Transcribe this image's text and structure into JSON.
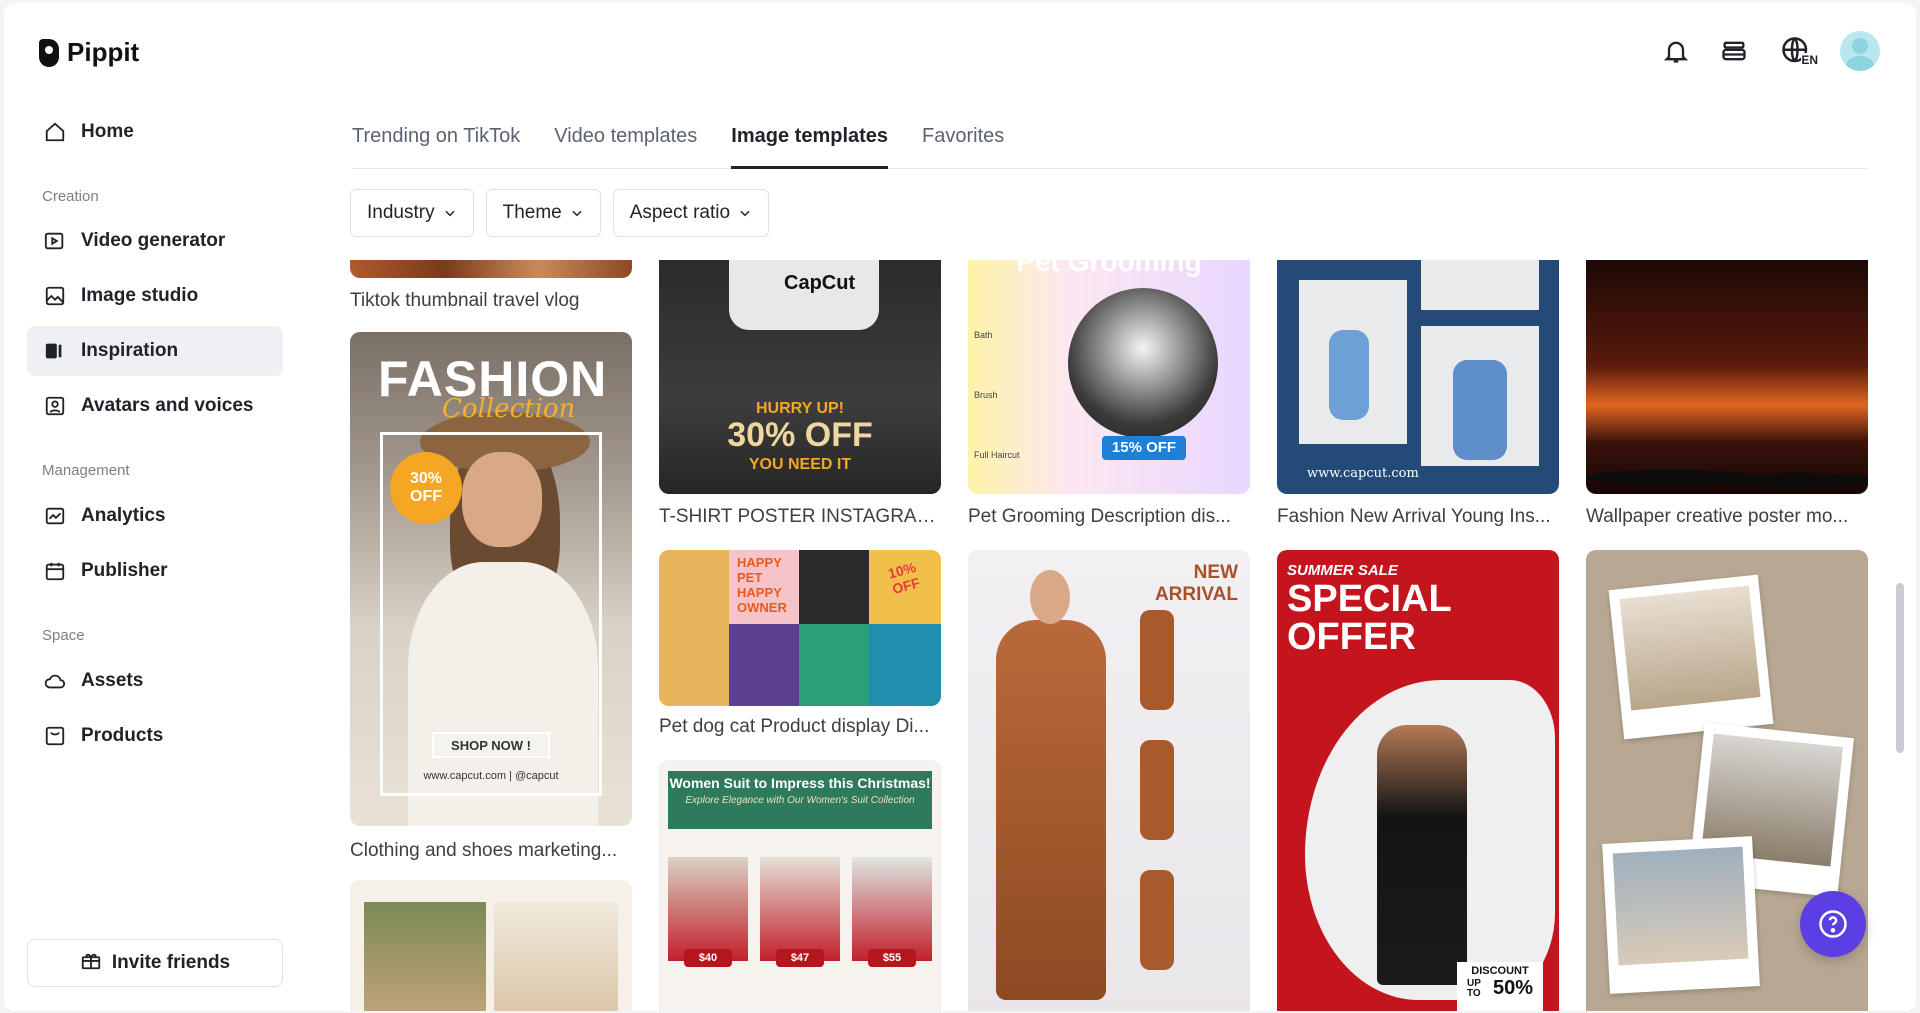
{
  "app": {
    "name": "Pippit"
  },
  "sidebar": {
    "home": "Home",
    "sections": {
      "creation": "Creation",
      "management": "Management",
      "space": "Space"
    },
    "items": {
      "video_generator": "Video generator",
      "image_studio": "Image studio",
      "inspiration": "Inspiration",
      "avatars": "Avatars and voices",
      "analytics": "Analytics",
      "publisher": "Publisher",
      "assets": "Assets",
      "products": "Products"
    },
    "invite": "Invite friends"
  },
  "header": {
    "lang_badge": "EN"
  },
  "tabs": [
    "Trending on TikTok",
    "Video templates",
    "Image templates",
    "Favorites"
  ],
  "filters": [
    "Industry",
    "Theme",
    "Aspect ratio"
  ],
  "cards": {
    "c1": {
      "caption": "Tiktok thumbnail travel vlog"
    },
    "c2": {
      "caption": "Clothing and shoes marketing...",
      "title": "FASHION",
      "subtitle": "Collection",
      "badge": "30% OFF",
      "cta": "SHOP NOW !",
      "footer": "www.capcut.com | @capcut"
    },
    "c3": {
      "caption": "T-SHIRT POSTER INSTAGRAM...",
      "brand": "CapCut",
      "line1": "HURRY UP!",
      "line2": "30% OFF",
      "line3": "YOU NEED IT"
    },
    "c4": {
      "caption": "Pet dog cat Product display Di...",
      "text": "HAPPY PET HAPPY OWNER",
      "badge": "10% OFF"
    },
    "c5": {
      "caption": "Women Suit to Impress this Christmas!",
      "title": "Women Suit to Impress this Christmas!",
      "subtitle": "Explore Elegance with Our Women's Suit Collection",
      "prices": [
        "$40",
        "$47",
        "$55"
      ]
    },
    "c6": {
      "caption": "Pet Grooming Description dis...",
      "title": "Pet Grooming",
      "badge": "15% OFF",
      "services": [
        "Bath",
        "Brush",
        "Full Haircut"
      ]
    },
    "c7": {
      "title": "NEW ARRIVAL"
    },
    "c8": {
      "caption": "Fashion New Arrival Young Ins...",
      "footer": "www.capcut.com"
    },
    "c9": {
      "title1": "SUMMER SALE",
      "title2": "SPECIAL OFFER",
      "discount": "DISCOUNT",
      "upto": "UP TO",
      "pct": "50%"
    },
    "c10": {
      "caption": "Wallpaper creative poster mo..."
    }
  },
  "colors": {
    "accent": "#5b3fe4",
    "active_bg": "#eef0f3"
  }
}
